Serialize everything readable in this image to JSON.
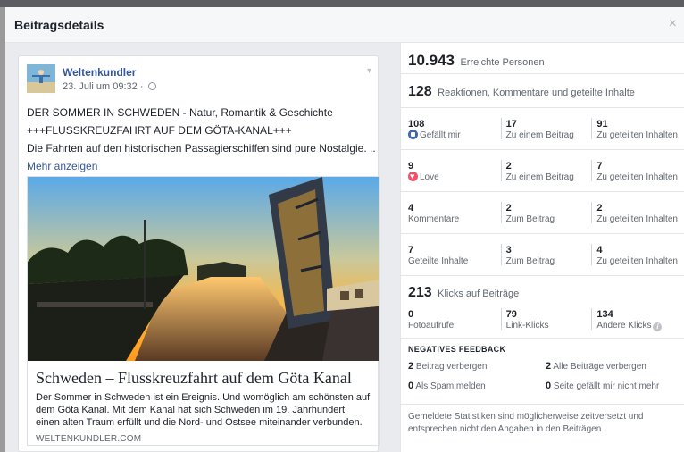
{
  "dialog": {
    "title": "Beitragsdetails",
    "close_glyph": "×"
  },
  "post": {
    "page_name": "Weltenkundler",
    "timestamp": "23. Juli um 09:32 ·",
    "lines": [
      "DER SOMMER IN SCHWEDEN - Natur, Romantik & Geschichte",
      "+++FLUSSKREUZFAHRT AUF DEM GÖTA-KANAL+++",
      "Die Fahrten auf den historischen Passagierschiffen sind pure Nostalgie. ..."
    ],
    "more_label": "Mehr anzeigen",
    "link": {
      "title": "Schweden – Flusskreuzfahrt auf dem Göta Kanal",
      "description": "Der Sommer in Schweden ist ein Ereignis. Und womöglich am schönsten auf dem Göta Kanal. Mit dem Kanal hat sich Schweden im 19. Jahrhundert einen alten Traum erfüllt und die Nord- und Ostsee miteinander verbunden.",
      "domain": "WELTENKUNDLER.COM"
    }
  },
  "stats": {
    "reach": {
      "value": "10.943",
      "label": "Erreichte Personen"
    },
    "reactions": {
      "value": "128",
      "label": "Reaktionen, Kommentare und geteilte Inhalte"
    },
    "rows": [
      {
        "icon": "like-icon",
        "c1_num": "108",
        "c1_label": "Gefällt mir",
        "c2_num": "17",
        "c2_label": "Zu einem Beitrag",
        "c3_num": "91",
        "c3_label": "Zu geteilten Inhalten"
      },
      {
        "icon": "love-icon",
        "c1_num": "9",
        "c1_label": "Love",
        "c2_num": "2",
        "c2_label": "Zu einem Beitrag",
        "c3_num": "7",
        "c3_label": "Zu geteilten Inhalten"
      },
      {
        "icon": "",
        "c1_num": "4",
        "c1_label": "Kommentare",
        "c2_num": "2",
        "c2_label": "Zum Beitrag",
        "c3_num": "2",
        "c3_label": "Zu geteilten Inhalten"
      },
      {
        "icon": "",
        "c1_num": "7",
        "c1_label": "Geteilte Inhalte",
        "c2_num": "3",
        "c2_label": "Zum Beitrag",
        "c3_num": "4",
        "c3_label": "Zu geteilten Inhalten"
      }
    ],
    "clicks": {
      "value": "213",
      "label": "Klicks auf Beiträge",
      "photo_num": "0",
      "photo_label": "Fotoaufrufe",
      "link_num": "79",
      "link_label": "Link-Klicks",
      "other_num": "134",
      "other_label": "Andere Klicks",
      "info_glyph": "i"
    },
    "negative": {
      "title": "NEGATIVES FEEDBACK",
      "items": [
        {
          "num": "2",
          "label": "Beitrag verbergen"
        },
        {
          "num": "2",
          "label": "Alle Beiträge verbergen"
        },
        {
          "num": "0",
          "label": "Als Spam melden"
        },
        {
          "num": "0",
          "label": "Seite gefällt mir nicht mehr"
        }
      ]
    },
    "footnote": "Gemeldete Statistiken sind möglicherweise zeitversetzt und entsprechen nicht den Angaben in den Beiträgen"
  },
  "colors": {
    "link_blue": "#365899",
    "like_blue": "#4267b2",
    "love_red": "#f25268"
  }
}
